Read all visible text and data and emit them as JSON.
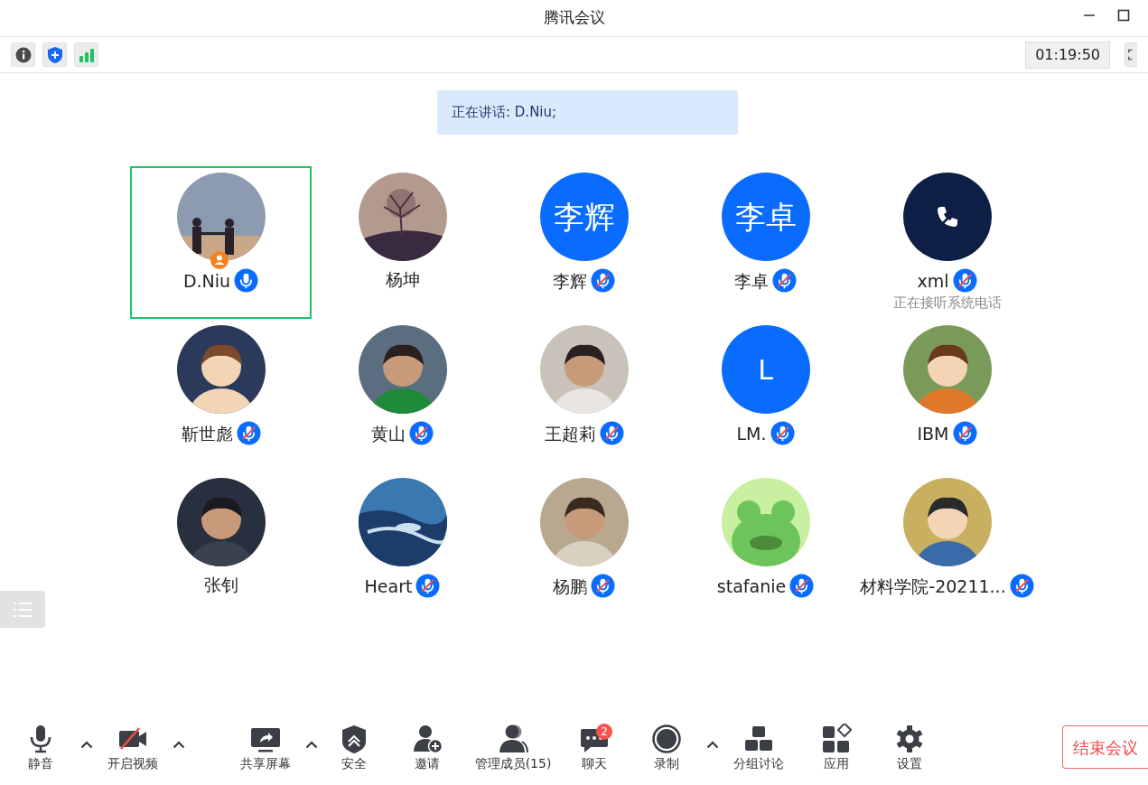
{
  "window": {
    "title": "腾讯会议"
  },
  "timer": "01:19:50",
  "speaking_banner": "正在讲话: D.Niu;",
  "participants": [
    {
      "name": "D.Niu",
      "host": true,
      "mic_muted": false,
      "selected": true
    },
    {
      "name": "杨坤",
      "host": false,
      "selected": false
    },
    {
      "name": "李辉",
      "avatar": {
        "kind": "initials",
        "text": "李辉"
      },
      "host": false,
      "mic_muted": true,
      "selected": false
    },
    {
      "name": "李卓",
      "avatar": {
        "kind": "initials",
        "text": "李卓"
      },
      "host": false,
      "mic_muted": true,
      "selected": false
    },
    {
      "name": "xml",
      "avatar": {
        "kind": "phone"
      },
      "host": false,
      "mic_muted": true,
      "selected": false,
      "status": "正在接听系统电话"
    },
    {
      "name": "靳世彪",
      "host": false,
      "mic_muted": true,
      "selected": false
    },
    {
      "name": "黄山",
      "host": false,
      "mic_muted": true,
      "selected": false
    },
    {
      "name": "王超莉",
      "host": false,
      "mic_muted": true,
      "selected": false
    },
    {
      "name": "LM.",
      "avatar": {
        "kind": "initials",
        "text": "L"
      },
      "host": false,
      "mic_muted": true,
      "selected": false
    },
    {
      "name": "IBM",
      "host": false,
      "mic_muted": true,
      "selected": false
    },
    {
      "name": "张钊",
      "host": false,
      "selected": false
    },
    {
      "name": "Heart",
      "host": false,
      "mic_muted": true,
      "selected": false
    },
    {
      "name": "杨鹏",
      "host": false,
      "mic_muted": true,
      "selected": false
    },
    {
      "name": "stafanie",
      "host": false,
      "mic_muted": true,
      "selected": false
    },
    {
      "name": "材料学院-20211...",
      "host": false,
      "mic_muted": true,
      "selected": false
    }
  ],
  "toolbar": [
    {
      "kind": "mic",
      "label": "静音",
      "caret": true
    },
    {
      "kind": "video_off",
      "label": "开启视频",
      "caret": true
    },
    {
      "kind": "share",
      "label": "共享屏幕",
      "caret": true
    },
    {
      "kind": "security",
      "label": "安全",
      "caret": false
    },
    {
      "kind": "invite",
      "label": "邀请",
      "caret": false
    },
    {
      "kind": "members",
      "label": "管理成员(15)",
      "caret": false
    },
    {
      "kind": "chat",
      "label": "聊天",
      "caret": false,
      "badge": "2"
    },
    {
      "kind": "record",
      "label": "录制",
      "caret": true
    },
    {
      "kind": "breakout",
      "label": "分组讨论",
      "caret": false
    },
    {
      "kind": "apps",
      "label": "应用",
      "caret": false
    },
    {
      "kind": "settings",
      "label": "设置",
      "caret": false
    }
  ],
  "end_button": "结束会议"
}
